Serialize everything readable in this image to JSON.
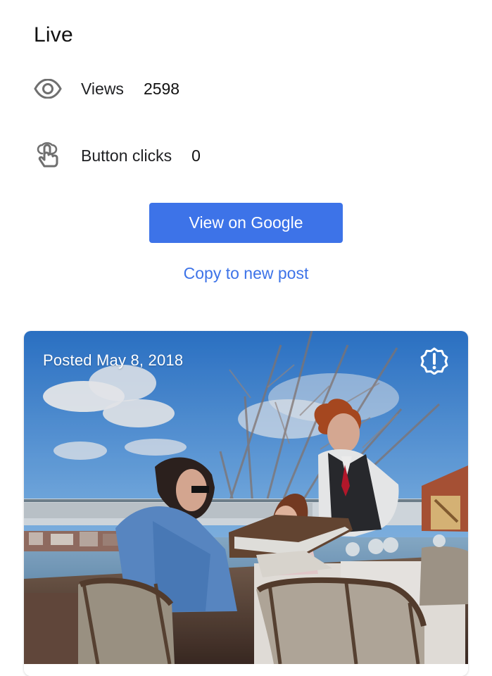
{
  "status": {
    "title": "Live"
  },
  "metrics": [
    {
      "icon": "eye-icon",
      "label": "Views",
      "value": "2598"
    },
    {
      "icon": "touch-icon",
      "label": "Button clicks",
      "value": "0"
    }
  ],
  "actions": {
    "primary_label": "View on Google",
    "secondary_label": "Copy to new post"
  },
  "post": {
    "date_label": "Posted May 8, 2018",
    "alert_icon": "alert-badge-icon",
    "image_icon": "restaurant-photo"
  },
  "colors": {
    "accent": "#3d73e8",
    "text": "#202124",
    "background": "#ffffff"
  }
}
